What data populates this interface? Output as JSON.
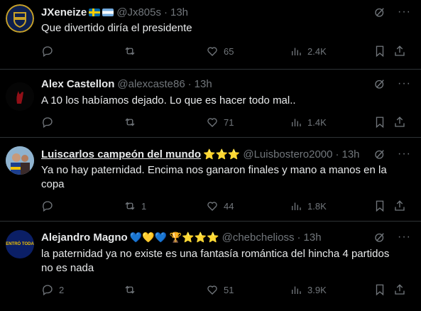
{
  "tweets": [
    {
      "name": "JXeneize",
      "emoji": "",
      "handle": "@Jx805s",
      "time": "13h",
      "text": "Que divertido diría el presidente",
      "replies": "",
      "reposts": "",
      "likes": "65",
      "views": "2.4K"
    },
    {
      "name": "Alex Castellon",
      "emoji": "",
      "handle": "@alexcaste86",
      "time": "13h",
      "text": "A 10 los habíamos dejado.  Lo que es hacer todo mal..",
      "replies": "",
      "reposts": "",
      "likes": "71",
      "views": "1.4K"
    },
    {
      "name": "Luiscarlos campeón del mundo",
      "emoji": "⭐⭐⭐",
      "handle": "@Luisbostero2000",
      "time": "13h",
      "text": "Ya no hay paternidad. Encima nos ganaron finales y mano a manos en la copa",
      "replies": "",
      "reposts": "1",
      "likes": "44",
      "views": "1.8K"
    },
    {
      "name": "Alejandro Magno",
      "emoji": "💙💛💙 🏆⭐⭐⭐",
      "handle": "@chebchelioss",
      "time": "13h",
      "text": "la paternidad ya no existe es una fantasía romántica del hincha 4 partidos no es nada",
      "replies": "2",
      "reposts": "",
      "likes": "51",
      "views": "3.9K",
      "avatar_text": "ENTRÓ TODA"
    }
  ],
  "separator": "·",
  "more": "···",
  "colors": {
    "bg": "#000000",
    "text": "#e7e9ea",
    "muted": "#71767b",
    "border": "#2f3336"
  },
  "icons": [
    "reply-icon",
    "repost-icon",
    "like-icon",
    "views-icon",
    "bookmark-icon",
    "share-icon",
    "grok-icon",
    "more-icon"
  ]
}
